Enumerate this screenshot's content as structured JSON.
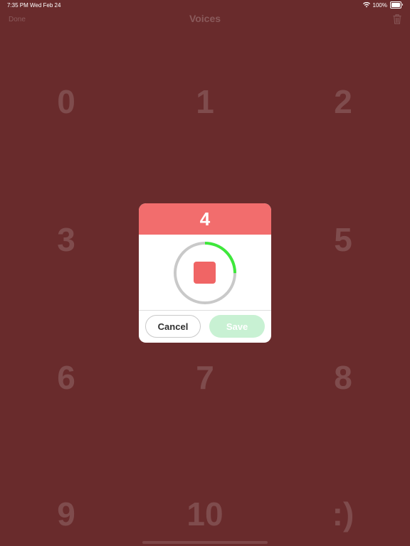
{
  "status_bar": {
    "time": "7:35 PM",
    "date": "Wed Feb 24",
    "battery": "100%"
  },
  "nav": {
    "done_label": "Done",
    "title": "Voices"
  },
  "grid": {
    "items": [
      "0",
      "1",
      "2",
      "3",
      "5",
      "6",
      "7",
      "8",
      "9",
      "10",
      ":)"
    ]
  },
  "dialog": {
    "number": "4",
    "progress": 0.25,
    "cancel_label": "Cancel",
    "save_label": "Save"
  },
  "colors": {
    "background": "#692b2c",
    "header": "#f26d6d",
    "stop": "#f06565",
    "progress": "#3ee83b",
    "ring": "#c9c9c9",
    "save_disabled": "#c8f1d3"
  }
}
